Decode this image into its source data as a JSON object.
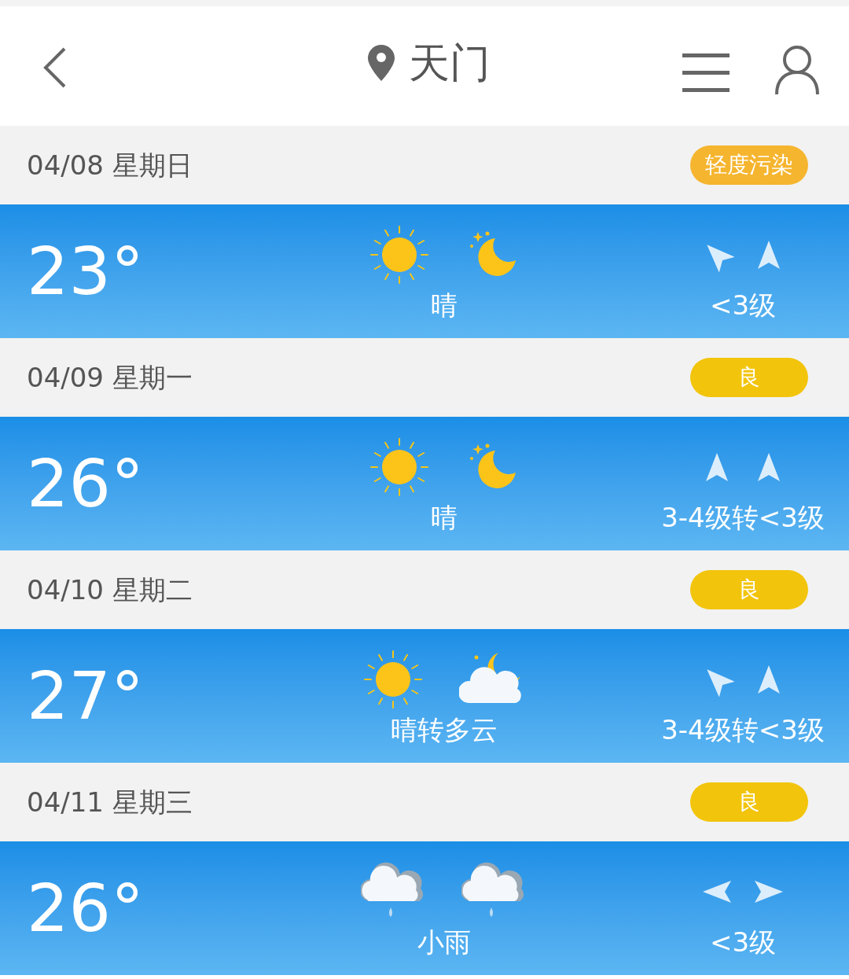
{
  "header": {
    "title": "天门"
  },
  "days": [
    {
      "date": "04/08 星期日",
      "aqi": "轻度污染",
      "color": "#f6b52f",
      "temp": "23°",
      "icons": [
        {
          "kind": "sun"
        },
        {
          "kind": "moon"
        }
      ],
      "condition": "晴",
      "arrows": [
        {
          "kind": "northwest"
        },
        {
          "kind": "north"
        }
      ],
      "wind": "<3级"
    },
    {
      "date": "04/09 星期一",
      "aqi": "良",
      "color": "#f2c40c",
      "temp": "26°",
      "icons": [
        {
          "kind": "sun"
        },
        {
          "kind": "moon"
        }
      ],
      "condition": "晴",
      "arrows": [
        {
          "kind": "north"
        },
        {
          "kind": "north"
        }
      ],
      "wind": "3-4级转<3级"
    },
    {
      "date": "04/10 星期二",
      "aqi": "良",
      "color": "#f2c40c",
      "temp": "27°",
      "icons": [
        {
          "kind": "sun"
        },
        {
          "kind": "cloudmoon"
        }
      ],
      "condition": "晴转多云",
      "arrows": [
        {
          "kind": "northwest"
        },
        {
          "kind": "north"
        }
      ],
      "wind": "3-4级转<3级"
    },
    {
      "date": "04/11 星期三",
      "aqi": "良",
      "color": "#f2c40c",
      "temp": "26°",
      "icons": [
        {
          "kind": "rain"
        },
        {
          "kind": "rain"
        }
      ],
      "condition": "小雨",
      "arrows": [
        {
          "kind": "west"
        },
        {
          "kind": "east"
        }
      ],
      "wind": "<3级"
    }
  ]
}
